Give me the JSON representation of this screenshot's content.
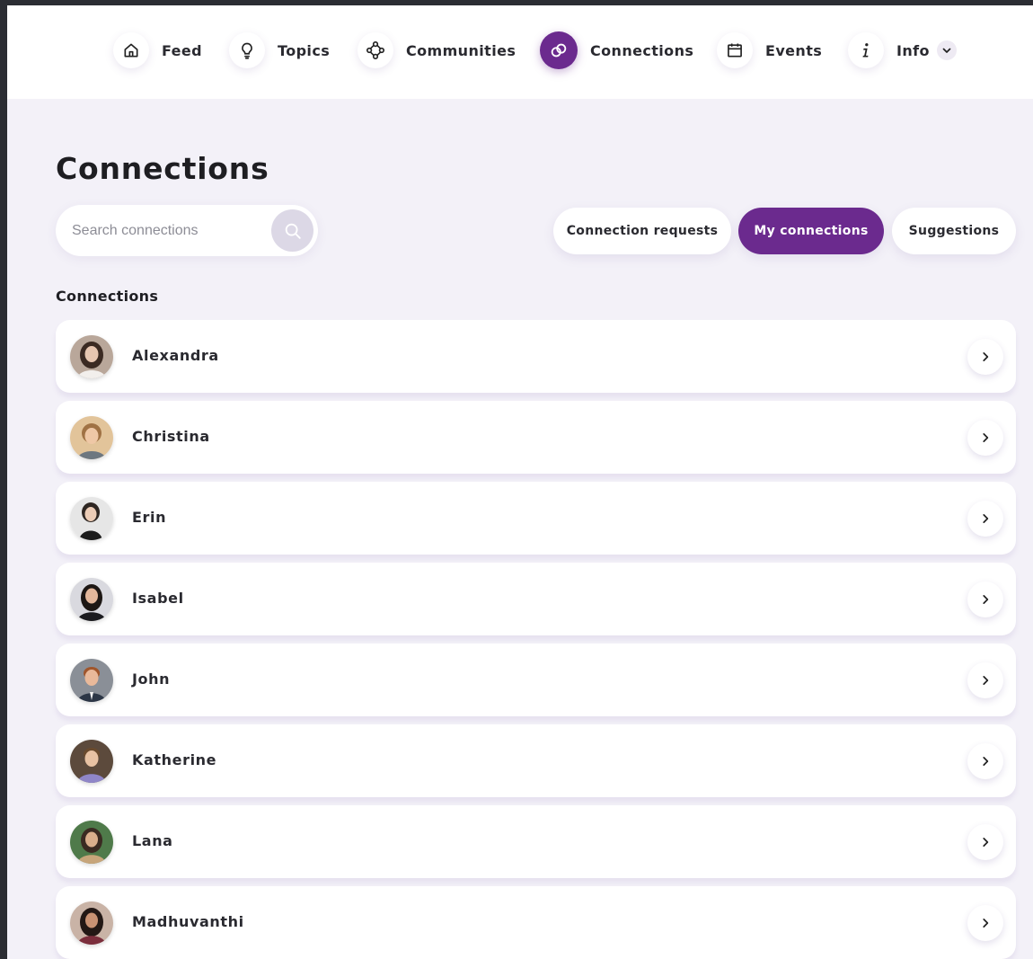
{
  "nav": {
    "items": [
      {
        "label": "Feed",
        "icon": "home-icon"
      },
      {
        "label": "Topics",
        "icon": "lightbulb-icon"
      },
      {
        "label": "Communities",
        "icon": "communities-icon"
      },
      {
        "label": "Connections",
        "icon": "link-icon",
        "active": true
      },
      {
        "label": "Events",
        "icon": "calendar-icon"
      },
      {
        "label": "Info",
        "icon": "info-icon",
        "dropdown": "chevron-down-icon"
      }
    ]
  },
  "page": {
    "title": "Connections",
    "search_placeholder": "Search connections",
    "search_value": "",
    "tabs": [
      {
        "label": "Connection requests"
      },
      {
        "label": "My connections",
        "active": true
      },
      {
        "label": "Suggestions"
      }
    ],
    "section_label": "Connections"
  },
  "connections": [
    {
      "name": "Alexandra"
    },
    {
      "name": "Christina"
    },
    {
      "name": "Erin"
    },
    {
      "name": "Isabel"
    },
    {
      "name": "John"
    },
    {
      "name": "Katherine"
    },
    {
      "name": "Lana"
    },
    {
      "name": "Madhuvanthi"
    }
  ],
  "colors": {
    "accent": "#6b2a8e",
    "page_background": "#f3f1f8",
    "card": "#ffffff",
    "text": "#1f1f24"
  }
}
